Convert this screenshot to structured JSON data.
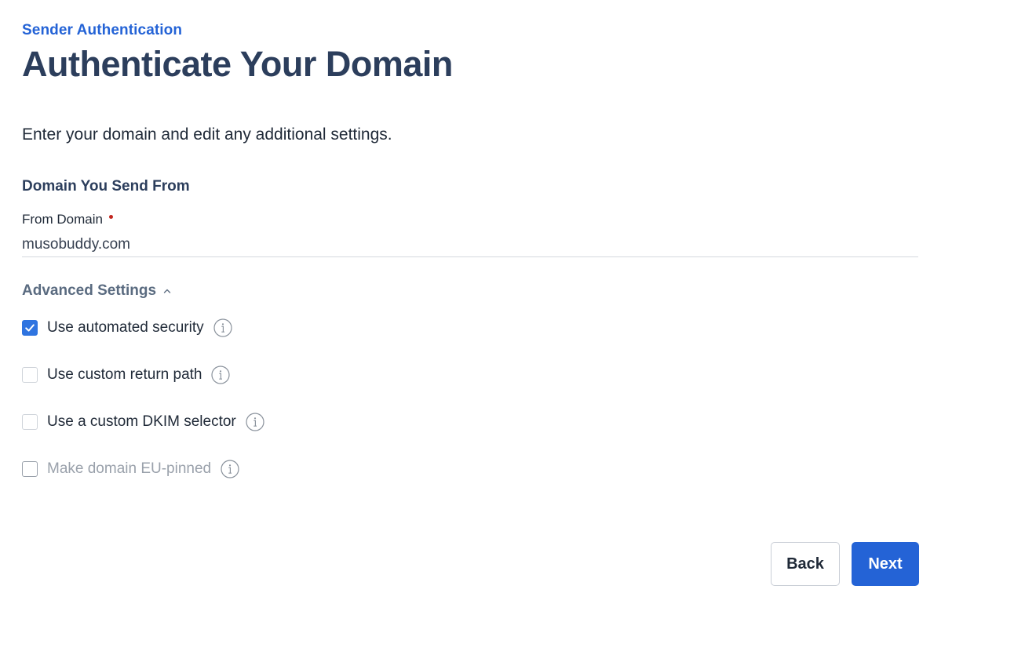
{
  "header": {
    "breadcrumb": "Sender Authentication",
    "title": "Authenticate Your Domain"
  },
  "intro": "Enter your domain and edit any additional settings.",
  "domain_section": {
    "heading": "Domain You Send From",
    "field_label": "From Domain",
    "field_value": "musobuddy.com",
    "required": true
  },
  "advanced": {
    "label": "Advanced Settings",
    "expanded": true,
    "options": [
      {
        "label": "Use automated security",
        "checked": true,
        "disabled": false
      },
      {
        "label": "Use custom return path",
        "checked": false,
        "disabled": false
      },
      {
        "label": "Use a custom DKIM selector",
        "checked": false,
        "disabled": false
      },
      {
        "label": "Make domain EU-pinned",
        "checked": false,
        "disabled": true
      }
    ]
  },
  "actions": {
    "back_label": "Back",
    "next_label": "Next"
  },
  "colors": {
    "accent": "#2463d6",
    "heading": "#2c3e5c",
    "checkbox_checked": "#2f74e0",
    "required": "#c2261f"
  }
}
